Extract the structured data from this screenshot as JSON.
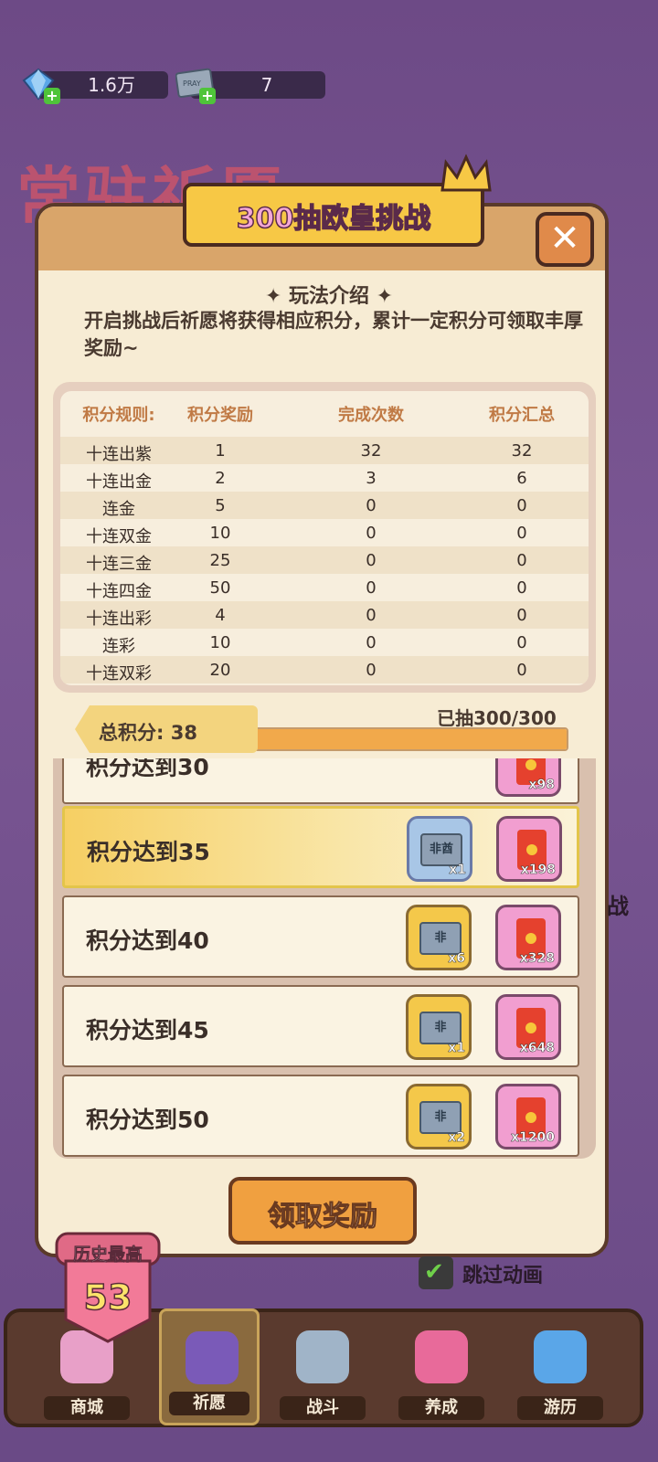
{
  "resources": [
    {
      "name": "gem",
      "value": "1.6万",
      "icon": "blue-gem-icon"
    },
    {
      "name": "pray-ticket",
      "value": "7",
      "icon": "pray-ticket-icon",
      "icon_text": "PRAY"
    }
  ],
  "background_title": "常驻祈愿",
  "modal": {
    "banner_title": "300抽欧皇挑战",
    "close_label": "✕",
    "intro_title": "✦ 玩法介绍 ✦",
    "intro_text": "开启挑战后祈愿将获得相应积分，累计一定积分可领取丰厚奖励~"
  },
  "score_table": {
    "headers": [
      "积分规则:",
      "积分奖励",
      "完成次数",
      "积分汇总"
    ],
    "rows": [
      [
        "十连出紫",
        "1",
        "32",
        "32"
      ],
      [
        "十连出金",
        "2",
        "3",
        "6"
      ],
      [
        "连金",
        "5",
        "0",
        "0"
      ],
      [
        "十连双金",
        "10",
        "0",
        "0"
      ],
      [
        "十连三金",
        "25",
        "0",
        "0"
      ],
      [
        "十连四金",
        "50",
        "0",
        "0"
      ],
      [
        "十连出彩",
        "4",
        "0",
        "0"
      ],
      [
        "连彩",
        "10",
        "0",
        "0"
      ],
      [
        "十连双彩",
        "20",
        "0",
        "0"
      ]
    ]
  },
  "progress": {
    "total_label": "总积分: 38",
    "drawn_label": "已抽300/300",
    "fraction": 1.0
  },
  "rewards": [
    {
      "label": "积分达到30",
      "partial": true,
      "items": [
        {
          "type": "red-envelope-icon",
          "qty": "x98",
          "bg": "pink"
        }
      ]
    },
    {
      "label": "积分达到35",
      "highlight": true,
      "items": [
        {
          "type": "fei-ticket-icon",
          "qty": "x1",
          "bg": "blue",
          "text": "非酋"
        },
        {
          "type": "red-envelope-icon",
          "qty": "x198",
          "bg": "pink"
        }
      ]
    },
    {
      "label": "积分达到40",
      "items": [
        {
          "type": "fei-ticket-icon",
          "qty": "x6",
          "bg": "gold",
          "text": "非"
        },
        {
          "type": "red-envelope-icon",
          "qty": "x328",
          "bg": "pink"
        }
      ]
    },
    {
      "label": "积分达到45",
      "items": [
        {
          "type": "fei-ticket-icon",
          "qty": "x1",
          "bg": "gold",
          "text": "非"
        },
        {
          "type": "red-envelope-icon",
          "qty": "x648",
          "bg": "pink"
        }
      ]
    },
    {
      "label": "积分达到50",
      "items": [
        {
          "type": "fei-ticket-icon",
          "qty": "x2",
          "bg": "gold",
          "text": "非"
        },
        {
          "type": "red-envelope-icon",
          "qty": "x1200",
          "bg": "pink"
        }
      ]
    }
  ],
  "claim_button": "领取奖励",
  "history": {
    "label": "历史最高",
    "value": "53"
  },
  "skip_animation": {
    "label": "跳过动画",
    "checked": true,
    "check_glyph": "✔"
  },
  "side_text": "战",
  "nav": [
    {
      "label": "商城",
      "icon": "shop-gift-icon"
    },
    {
      "label": "祈愿",
      "icon": "pray-card-icon",
      "active": true
    },
    {
      "label": "战斗",
      "icon": "crossed-swords-icon"
    },
    {
      "label": "养成",
      "icon": "paw-icon"
    },
    {
      "label": "游历",
      "icon": "map-icon"
    }
  ],
  "colors": {
    "accent": "#f1a94b",
    "highlight": "#f6cf63",
    "banner_text": "#f4a8d6"
  }
}
